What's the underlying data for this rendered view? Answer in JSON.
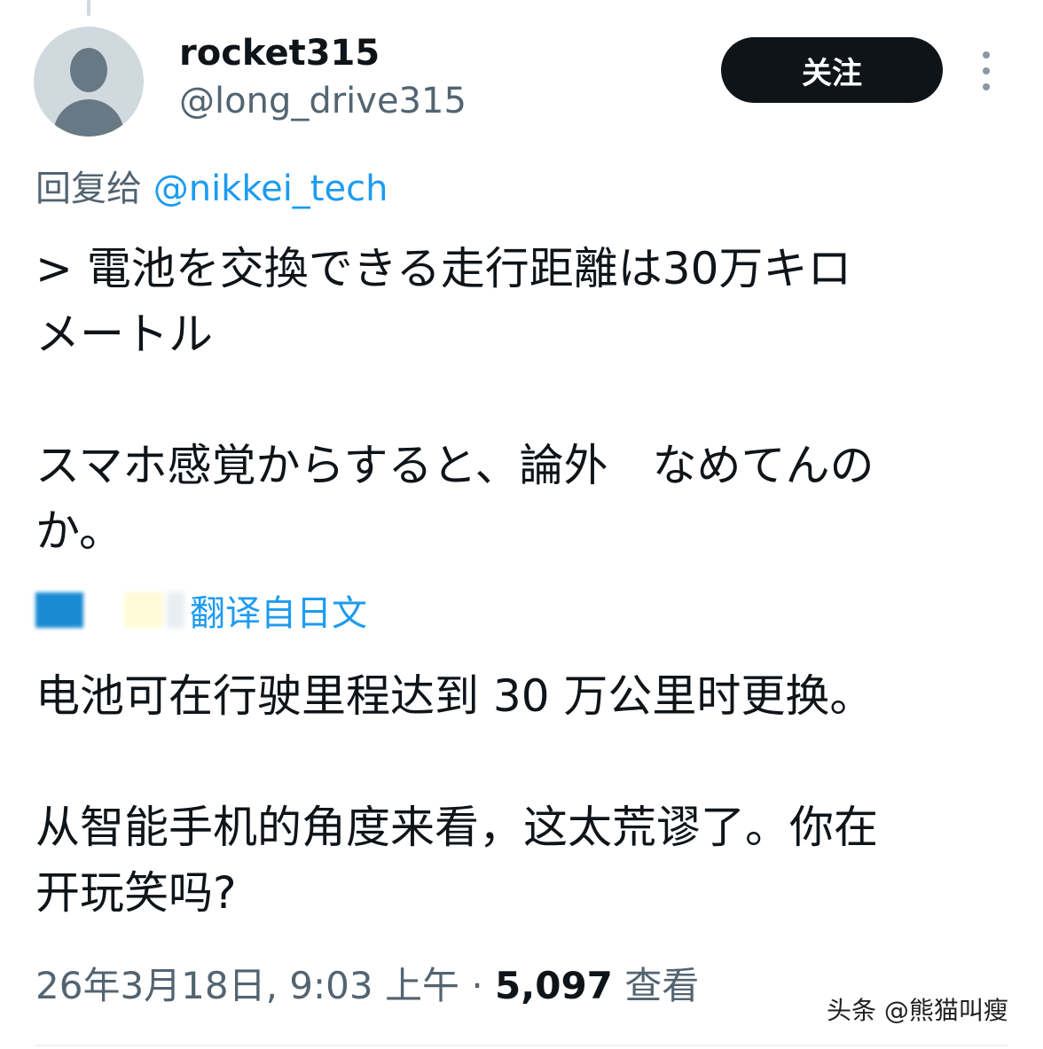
{
  "tweet": {
    "display_name": "rocket315",
    "handle": "@long_drive315",
    "follow_label": "关注",
    "reply_prefix": "回复给 ",
    "reply_mention": "@nikkei_tech",
    "original_text": "> 電池を交換できる走行距離は30万キロ\nメートル\n\nスマホ感覚からすると、論外　なめてんの\nか。",
    "translate_label": "翻译自日文",
    "translated_text": "电池可在行驶里程达到 30 万公里时更换。\n\n从智能手机的角度来看，这太荒谬了。你在\n开玩笑吗?",
    "timestamp": "26年3月18日, 9:03 上午",
    "separator": " · ",
    "views_count": "5,097",
    "views_label": " 查看"
  },
  "watermark": "头条 @熊猫叫瘦",
  "icons": {
    "avatar": "default-avatar-icon",
    "more": "more-vertical-icon"
  },
  "colors": {
    "text": "#0f1419",
    "secondary": "#536471",
    "link": "#1d9bf0",
    "button": "#0f1419"
  }
}
